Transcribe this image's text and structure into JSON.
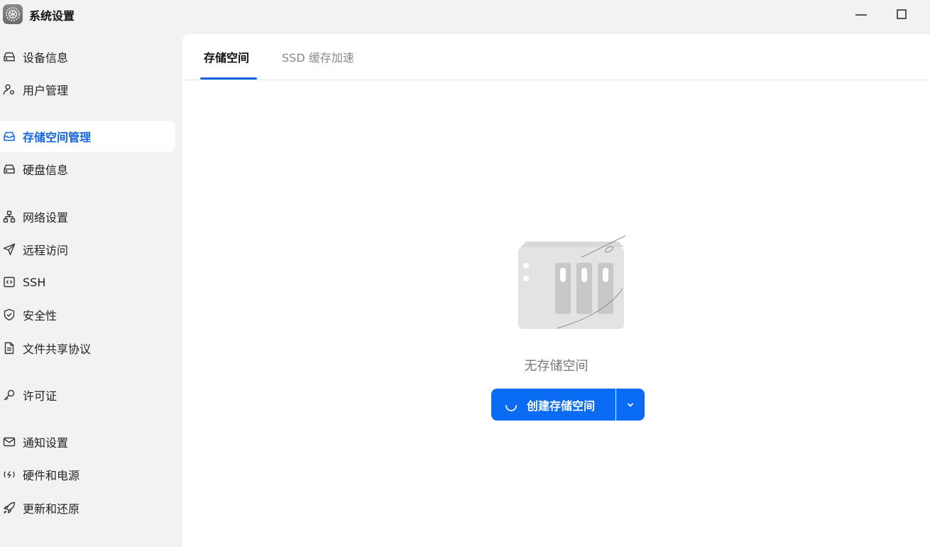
{
  "window": {
    "title": "系统设置",
    "icon": "gear-app-icon"
  },
  "sidebar": {
    "items": [
      {
        "label": "设备信息",
        "icon": "device-icon"
      },
      {
        "label": "用户管理",
        "icon": "user-gear-icon"
      },
      {
        "label": "存储空间管理",
        "icon": "storage-icon",
        "active": true
      },
      {
        "label": "硬盘信息",
        "icon": "disk-icon"
      },
      {
        "label": "网络设置",
        "icon": "network-icon"
      },
      {
        "label": "远程访问",
        "icon": "send-icon"
      },
      {
        "label": "SSH",
        "icon": "code-icon"
      },
      {
        "label": "安全性",
        "icon": "shield-icon"
      },
      {
        "label": "文件共享协议",
        "icon": "document-icon"
      },
      {
        "label": "许可证",
        "icon": "key-icon"
      },
      {
        "label": "通知设置",
        "icon": "mail-icon"
      },
      {
        "label": "硬件和电源",
        "icon": "power-icon"
      },
      {
        "label": "更新和还原",
        "icon": "rocket-icon"
      }
    ]
  },
  "main": {
    "tabs": [
      {
        "label": "存储空间",
        "active": true
      },
      {
        "label": "SSD 缓存加速",
        "active": false
      }
    ],
    "empty_text": "无存储空间",
    "create_button": "创建存储空间"
  },
  "colors": {
    "accent": "#0a6cf5",
    "active_text": "#1565e0"
  }
}
